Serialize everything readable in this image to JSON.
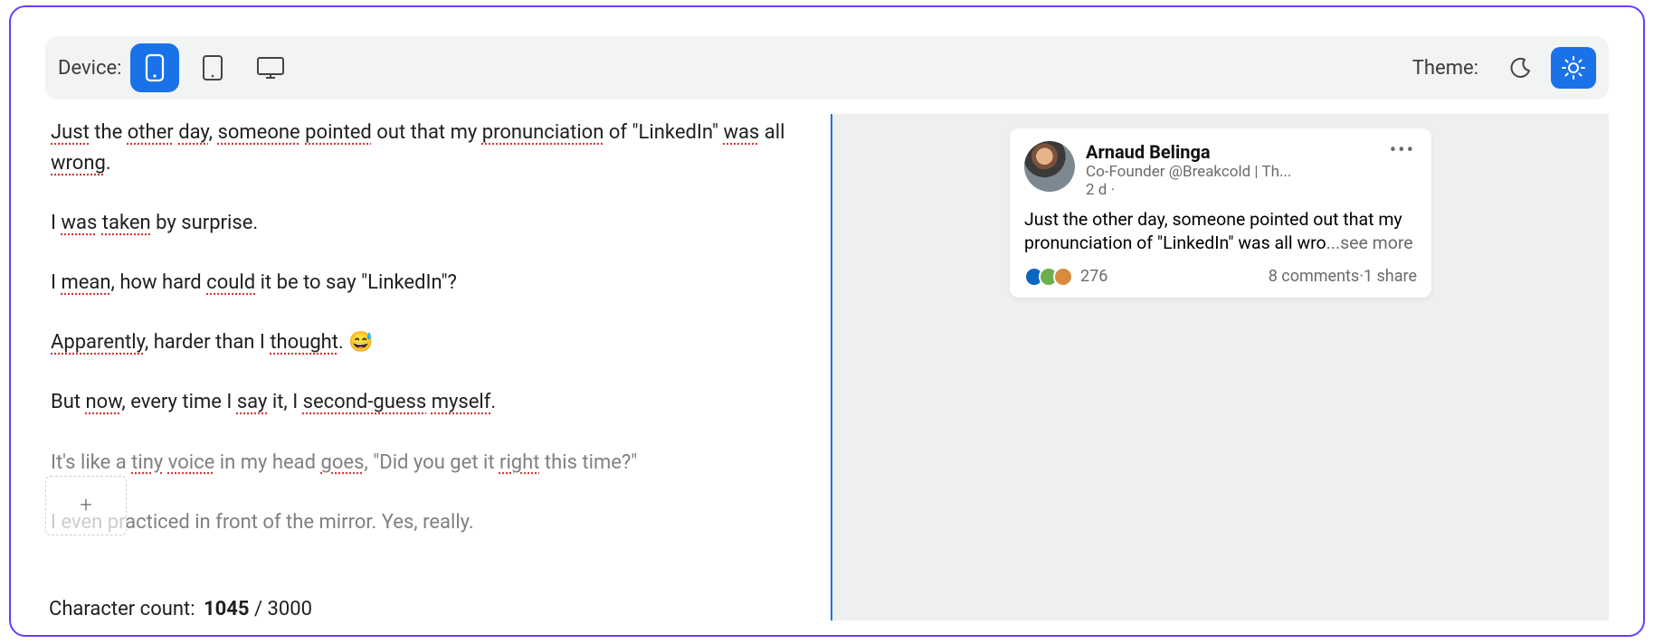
{
  "toolbar": {
    "device_label": "Device:",
    "theme_label": "Theme:",
    "device_selected": "phone",
    "theme_selected": "light"
  },
  "editor": {
    "paragraphs": {
      "p1_a": "Just",
      "p1_b": " the ",
      "p1_c": "other",
      "p1_d": " ",
      "p1_e": "day",
      "p1_f": ", ",
      "p1_g": "someone",
      "p1_h": " ",
      "p1_i": "pointed",
      "p1_j": " out that my ",
      "p1_k": "pronunciation",
      "p1_l": " of \"LinkedIn\" ",
      "p1_m": "was",
      "p1_n": " all ",
      "p1_o": "wrong",
      "p1_p": ".",
      "p2_a": "I ",
      "p2_b": "was",
      "p2_c": " ",
      "p2_d": "taken",
      "p2_e": " by surprise.",
      "p3_a": "I ",
      "p3_b": "mean",
      "p3_c": ", how hard ",
      "p3_d": "could",
      "p3_e": " it be to say \"LinkedIn\"?",
      "p4_a": "Apparently",
      "p4_b": ", harder than I ",
      "p4_c": "thought",
      "p4_d": ". 😅",
      "p5_a": "But ",
      "p5_b": "now",
      "p5_c": ", every time I ",
      "p5_d": "say",
      "p5_e": " it, I ",
      "p5_f": "second-guess",
      "p5_g": " ",
      "p5_h": "myself",
      "p5_i": ".",
      "p6_a": "It's like a ",
      "p6_b": "tiny",
      "p6_c": " ",
      "p6_d": "voice",
      "p6_e": " in my head ",
      "p6_f": "goes",
      "p6_g": ", \"Did you get it ",
      "p6_h": "right",
      "p6_i": " this time?\"",
      "p7": "I even practiced in front of the mirror. Yes, really."
    }
  },
  "char_counter": {
    "label": "Character count:",
    "current": "1045",
    "sep": " / ",
    "max": "3000"
  },
  "preview": {
    "author_name": "Arnaud Belinga",
    "headline": "Co-Founder @Breakcold | Th...",
    "time": "2 d ·",
    "body_visible": "Just the other day, someone pointed out that my pronunciation of \"LinkedIn\" was all wro",
    "see_more": "...see more",
    "reactions_count": "276",
    "comments": "8 comments",
    "sep": " · ",
    "shares": "1 share"
  }
}
